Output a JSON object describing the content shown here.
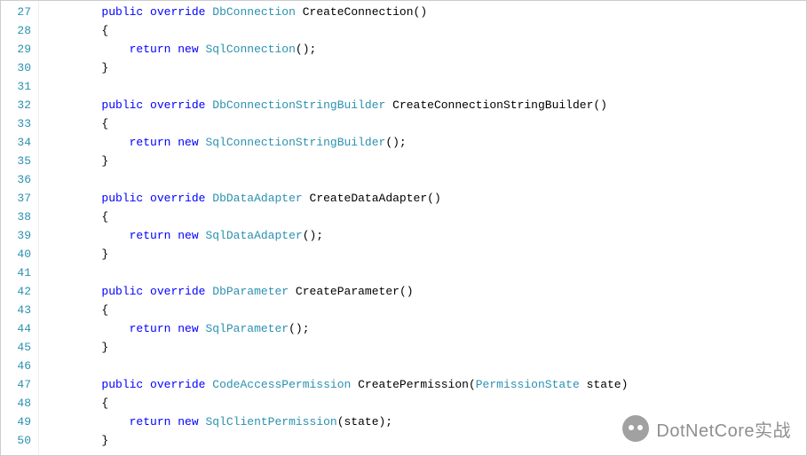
{
  "watermark": {
    "text": "DotNetCore实战"
  },
  "lines": [
    {
      "num": 27,
      "indent": 2,
      "tokens": [
        {
          "t": "kw",
          "v": "public"
        },
        {
          "t": "sp"
        },
        {
          "t": "kw",
          "v": "override"
        },
        {
          "t": "sp"
        },
        {
          "t": "typ",
          "v": "DbConnection"
        },
        {
          "t": "sp"
        },
        {
          "t": "plain",
          "v": "CreateConnection()"
        }
      ]
    },
    {
      "num": 28,
      "indent": 2,
      "tokens": [
        {
          "t": "plain",
          "v": "{"
        }
      ]
    },
    {
      "num": 29,
      "indent": 3,
      "tokens": [
        {
          "t": "kw",
          "v": "return"
        },
        {
          "t": "sp"
        },
        {
          "t": "kw",
          "v": "new"
        },
        {
          "t": "sp"
        },
        {
          "t": "typ",
          "v": "SqlConnection"
        },
        {
          "t": "plain",
          "v": "();"
        }
      ]
    },
    {
      "num": 30,
      "indent": 2,
      "tokens": [
        {
          "t": "plain",
          "v": "}"
        }
      ]
    },
    {
      "num": 31,
      "indent": 0,
      "tokens": []
    },
    {
      "num": 32,
      "indent": 2,
      "tokens": [
        {
          "t": "kw",
          "v": "public"
        },
        {
          "t": "sp"
        },
        {
          "t": "kw",
          "v": "override"
        },
        {
          "t": "sp"
        },
        {
          "t": "typ",
          "v": "DbConnectionStringBuilder"
        },
        {
          "t": "sp"
        },
        {
          "t": "plain",
          "v": "CreateConnectionStringBuilder()"
        }
      ]
    },
    {
      "num": 33,
      "indent": 2,
      "tokens": [
        {
          "t": "plain",
          "v": "{"
        }
      ]
    },
    {
      "num": 34,
      "indent": 3,
      "tokens": [
        {
          "t": "kw",
          "v": "return"
        },
        {
          "t": "sp"
        },
        {
          "t": "kw",
          "v": "new"
        },
        {
          "t": "sp"
        },
        {
          "t": "typ",
          "v": "SqlConnectionStringBuilder"
        },
        {
          "t": "plain",
          "v": "();"
        }
      ]
    },
    {
      "num": 35,
      "indent": 2,
      "tokens": [
        {
          "t": "plain",
          "v": "}"
        }
      ]
    },
    {
      "num": 36,
      "indent": 0,
      "tokens": []
    },
    {
      "num": 37,
      "indent": 2,
      "tokens": [
        {
          "t": "kw",
          "v": "public"
        },
        {
          "t": "sp"
        },
        {
          "t": "kw",
          "v": "override"
        },
        {
          "t": "sp"
        },
        {
          "t": "typ",
          "v": "DbDataAdapter"
        },
        {
          "t": "sp"
        },
        {
          "t": "plain",
          "v": "CreateDataAdapter()"
        }
      ]
    },
    {
      "num": 38,
      "indent": 2,
      "tokens": [
        {
          "t": "plain",
          "v": "{"
        }
      ]
    },
    {
      "num": 39,
      "indent": 3,
      "tokens": [
        {
          "t": "kw",
          "v": "return"
        },
        {
          "t": "sp"
        },
        {
          "t": "kw",
          "v": "new"
        },
        {
          "t": "sp"
        },
        {
          "t": "typ",
          "v": "SqlDataAdapter"
        },
        {
          "t": "plain",
          "v": "();"
        }
      ]
    },
    {
      "num": 40,
      "indent": 2,
      "tokens": [
        {
          "t": "plain",
          "v": "}"
        }
      ]
    },
    {
      "num": 41,
      "indent": 0,
      "tokens": []
    },
    {
      "num": 42,
      "indent": 2,
      "tokens": [
        {
          "t": "kw",
          "v": "public"
        },
        {
          "t": "sp"
        },
        {
          "t": "kw",
          "v": "override"
        },
        {
          "t": "sp"
        },
        {
          "t": "typ",
          "v": "DbParameter"
        },
        {
          "t": "sp"
        },
        {
          "t": "plain",
          "v": "CreateParameter()"
        }
      ]
    },
    {
      "num": 43,
      "indent": 2,
      "tokens": [
        {
          "t": "plain",
          "v": "{"
        }
      ]
    },
    {
      "num": 44,
      "indent": 3,
      "tokens": [
        {
          "t": "kw",
          "v": "return"
        },
        {
          "t": "sp"
        },
        {
          "t": "kw",
          "v": "new"
        },
        {
          "t": "sp"
        },
        {
          "t": "typ",
          "v": "SqlParameter"
        },
        {
          "t": "plain",
          "v": "();"
        }
      ]
    },
    {
      "num": 45,
      "indent": 2,
      "tokens": [
        {
          "t": "plain",
          "v": "}"
        }
      ]
    },
    {
      "num": 46,
      "indent": 0,
      "tokens": []
    },
    {
      "num": 47,
      "indent": 2,
      "tokens": [
        {
          "t": "kw",
          "v": "public"
        },
        {
          "t": "sp"
        },
        {
          "t": "kw",
          "v": "override"
        },
        {
          "t": "sp"
        },
        {
          "t": "typ",
          "v": "CodeAccessPermission"
        },
        {
          "t": "sp"
        },
        {
          "t": "plain",
          "v": "CreatePermission("
        },
        {
          "t": "typ",
          "v": "PermissionState"
        },
        {
          "t": "sp"
        },
        {
          "t": "plain",
          "v": "state)"
        }
      ]
    },
    {
      "num": 48,
      "indent": 2,
      "tokens": [
        {
          "t": "plain",
          "v": "{"
        }
      ]
    },
    {
      "num": 49,
      "indent": 3,
      "tokens": [
        {
          "t": "kw",
          "v": "return"
        },
        {
          "t": "sp"
        },
        {
          "t": "kw",
          "v": "new"
        },
        {
          "t": "sp"
        },
        {
          "t": "typ",
          "v": "SqlClientPermission"
        },
        {
          "t": "plain",
          "v": "(state);"
        }
      ]
    },
    {
      "num": 50,
      "indent": 2,
      "tokens": [
        {
          "t": "plain",
          "v": "}"
        }
      ]
    }
  ]
}
